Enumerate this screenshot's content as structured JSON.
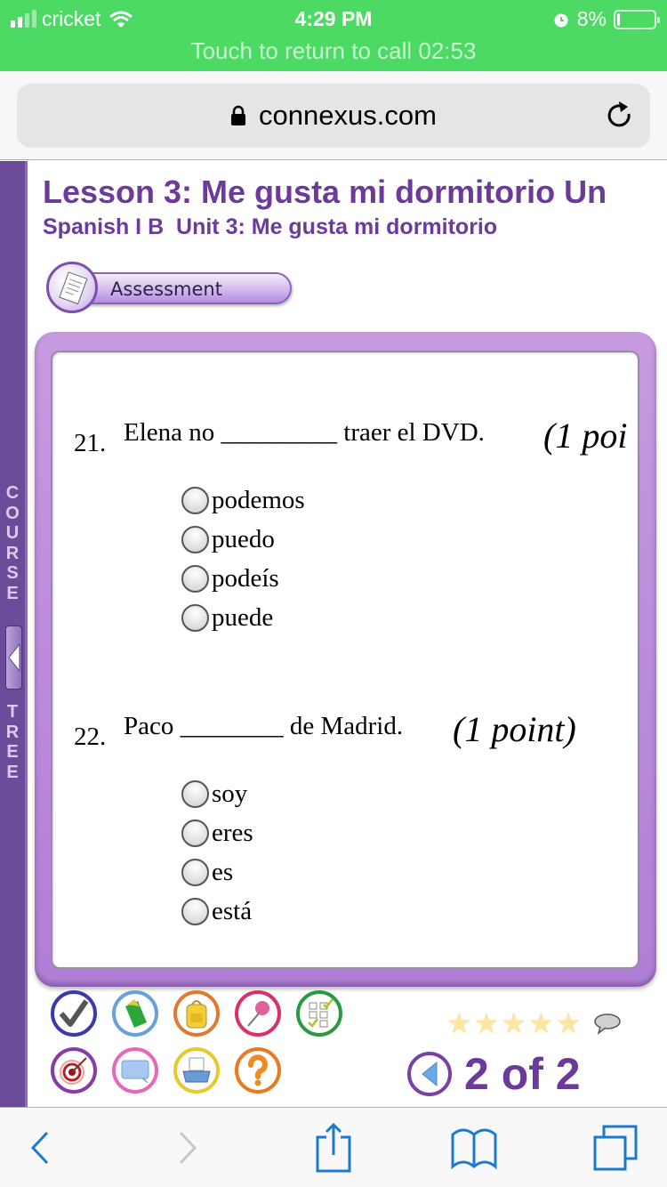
{
  "status_bar": {
    "carrier": "cricket",
    "time": "4:29 PM",
    "battery": "8%",
    "battery_level": 0.08,
    "call_banner": "Touch to return to call 02:53",
    "background_color": "#4cd964"
  },
  "browser": {
    "url": "connexus.com"
  },
  "course_tree": {
    "top_label": [
      "C",
      "O",
      "U",
      "R",
      "S",
      "E"
    ],
    "bottom_label": [
      "T",
      "R",
      "E",
      "E"
    ]
  },
  "page": {
    "lesson_title": "Lesson 3: Me gusta mi dormitorio Un",
    "unit_title": "Spanish I B  Unit 3: Me gusta mi dormitorio",
    "section_button": "Assessment",
    "accent_color": "#6b3a9a"
  },
  "questions": [
    {
      "number": "21.",
      "text": "Elena no _________ traer el DVD.",
      "points": "(1 poi",
      "options": [
        "podemos",
        "puedo",
        "podeís",
        "puede"
      ]
    },
    {
      "number": "22.",
      "text": "Paco ________ de Madrid.",
      "points": "(1 point)",
      "options": [
        "soy",
        "eres",
        "es",
        "está"
      ]
    }
  ],
  "tools": {
    "row1": [
      "check-tool",
      "notebook-tool",
      "backpack-tool",
      "pushpin-tool",
      "checklist-tool"
    ],
    "row2": [
      "target-tool",
      "message-tool",
      "print-tool",
      "help-tool"
    ]
  },
  "rating": {
    "stars_total": 5,
    "stars_filled": 0
  },
  "pager": {
    "label": "2 of 2",
    "current": 2,
    "total": 2
  }
}
